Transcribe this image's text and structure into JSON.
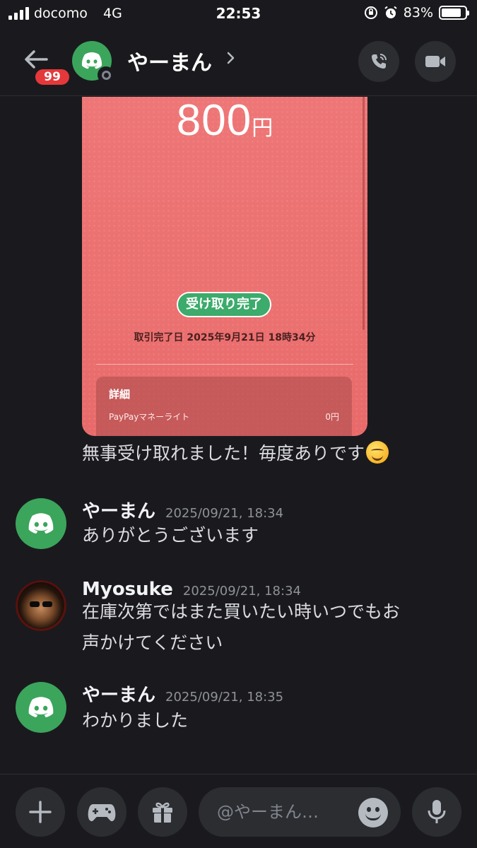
{
  "status_bar": {
    "carrier": "docomo",
    "network": "4G",
    "time": "22:53",
    "battery": "83%",
    "battery_level": 0.83
  },
  "header": {
    "unread_badge": "99",
    "title": "やーまん",
    "chevron": "›",
    "icons": [
      "back-arrow-icon",
      "discord-logo-icon",
      "phone-call-icon",
      "video-camera-icon"
    ]
  },
  "payment_card": {
    "amount": "800",
    "currency": "円",
    "status_pill": "受け取り完了",
    "completed_date": "取引完了日 2025年9月21日 18時34分",
    "detail_title": "詳細",
    "detail_row_label": "PayPayマネーライト",
    "detail_row_value": "0円"
  },
  "messages": [
    {
      "text": "無事受け取れました！毎度ありです",
      "emoji": "smiling-face-emoji"
    },
    {
      "author": "やーまん",
      "timestamp": "2025/09/21, 18:34",
      "lines": [
        "ありがとうございます"
      ]
    },
    {
      "author": "Myosuke",
      "timestamp": "2025/09/21, 18:34",
      "lines": [
        "在庫次第ではまた買いたい時いつでもお",
        "声かけてください"
      ]
    },
    {
      "author": "やーまん",
      "timestamp": "2025/09/21, 18:35",
      "lines": [
        "わかりました"
      ]
    }
  ],
  "composer": {
    "placeholder": "@やーまん…",
    "icons": [
      "plus-icon",
      "gamepad-icon",
      "gift-icon",
      "emoji-icon",
      "microphone-icon"
    ]
  },
  "colors": {
    "background": "#1a1a1e",
    "discord_green": "#3ba55c",
    "badge_red": "#e5383b",
    "paypay_card": "#ee7676",
    "pill_green": "#3cab6b"
  }
}
